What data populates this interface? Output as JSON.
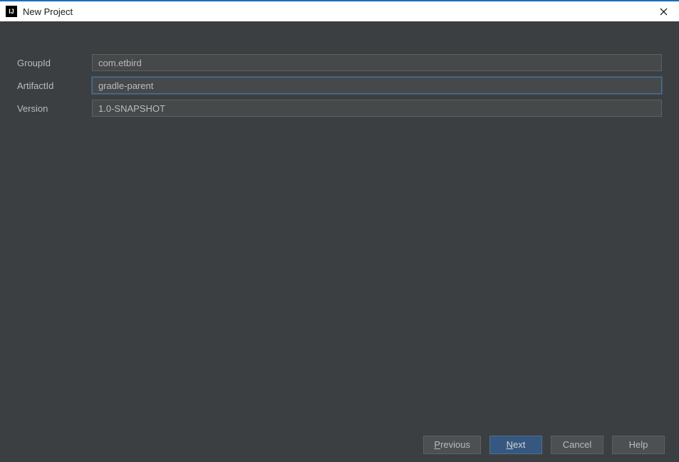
{
  "window": {
    "title": "New Project",
    "icon_text": "IJ"
  },
  "form": {
    "groupId": {
      "label": "GroupId",
      "value": "com.etbird"
    },
    "artifactId": {
      "label": "ArtifactId",
      "value": "gradle-parent"
    },
    "version": {
      "label": "Version",
      "value": "1.0-SNAPSHOT"
    }
  },
  "buttons": {
    "previous": {
      "mnemonic": "P",
      "rest": "revious"
    },
    "next": {
      "mnemonic": "N",
      "rest": "ext"
    },
    "cancel": "Cancel",
    "help": "Help"
  }
}
